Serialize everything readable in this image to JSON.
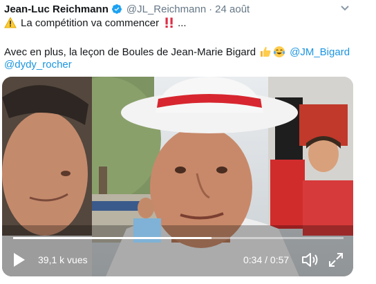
{
  "tweet": {
    "author_name": "Jean-Luc Reichmann",
    "handle": "@JL_Reichmann",
    "separator": "·",
    "date": "24 août",
    "line1_text": "La compétition va commencer",
    "line1_suffix": "...",
    "line2_text": "Avec en plus, la leçon de Boules de Jean-Marie Bigard",
    "mention1": "@JM_Bigard",
    "mention2": "@dydy_rocher",
    "icons": {
      "verified": "verified-badge-icon",
      "warning": "warning-emoji",
      "exclamation": "double-exclamation-emoji",
      "thumbs_up": "thumbs-up-emoji",
      "laughing": "tears-of-joy-emoji",
      "caret": "chevron-down-icon"
    },
    "colors": {
      "link": "#1b95e0",
      "verified": "#1da1f2",
      "secondary_text": "#657786"
    }
  },
  "video": {
    "views": "39,1 k vues",
    "time": "0:34 / 0:57",
    "progress": 0.6
  }
}
